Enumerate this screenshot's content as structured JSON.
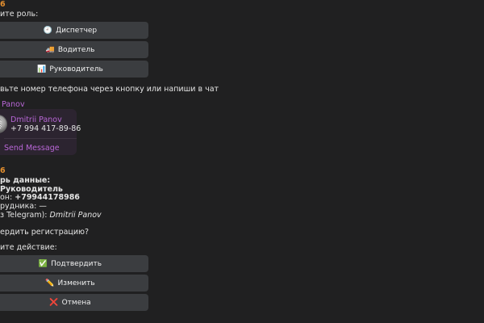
{
  "messages": {
    "role_header_partial": "6",
    "role_prompt_partial": "ите роль:",
    "role_buttons": [
      {
        "emoji": "🕘",
        "label": "Диспетчер"
      },
      {
        "emoji": "🚚",
        "label": "Водитель"
      },
      {
        "emoji": "📊",
        "label": "Руководитель"
      }
    ],
    "phone_prompt_partial": "вьте номер телефона через кнопку или напиши в чат",
    "contact": {
      "sender_partial": "Panov",
      "name": "Dmitrii Panov",
      "phone": "+7 994 417-89-86",
      "action": "Send Message"
    },
    "summary": {
      "header_partial": "6",
      "title_partial": "рь данные:",
      "role_line_partial": "Руководитель",
      "phone_label_partial": "он: ",
      "phone_value": "+79944178986",
      "employee_line_partial": "рудника: —",
      "tg_label_partial": "з Telegram): ",
      "tg_value": "Dmitrii Panov",
      "confirm_question_partial": "ердить регистрацию?"
    },
    "action_prompt_partial": "ите действие:",
    "action_buttons": [
      {
        "emoji": "✅",
        "label": "Подтвердить"
      },
      {
        "emoji": "✏️",
        "label": "Изменить"
      },
      {
        "emoji": "❌",
        "label": "Отмена"
      }
    ]
  },
  "colors": {
    "background": "#202021",
    "button": "#3b3d40",
    "accent_orange": "#e38f2f",
    "accent_purple": "#b866d6",
    "contact_card": "#2c2430"
  }
}
